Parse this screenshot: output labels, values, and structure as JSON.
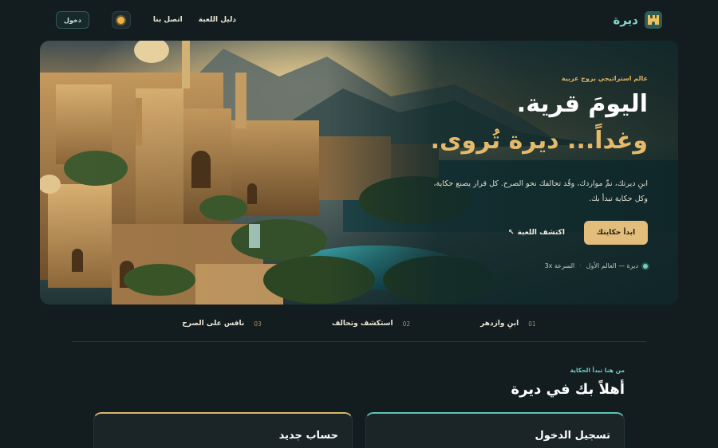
{
  "nav": {
    "brand": "ديرة",
    "links": [
      "دليل اللعبة",
      "اتصل بنا"
    ],
    "login_label": "دخول",
    "theme_icon": "sun-icon"
  },
  "hero": {
    "eyebrow": "عالم استراتيجي بروح عربية",
    "headline_line1": "اليومَ قرية.",
    "headline_line2": "وغداً... ديرة تُروى.",
    "lede": "ابنِ ديرتك، نمِّ مواردك، وقُد تحالفك نحو الصرح. كل قرار يصنع حكاية، وكل حكاية تبدأ بك.",
    "cta_primary": "ابدأ حكايتك",
    "cta_secondary": "اكتشف اللعبة",
    "cta_secondary_icon": "arrow-up-left-icon",
    "meta_world": "ديرة — العالم الأول",
    "meta_speed": "السرعة 3x"
  },
  "steps": [
    {
      "num": "01",
      "label": "ابنِ وازدهر"
    },
    {
      "num": "02",
      "label": "استكشف وتحالف"
    },
    {
      "num": "03",
      "label": "نافس على الصرح"
    }
  ],
  "welcome": {
    "eyebrow": "من هنا تبدأ الحكاية",
    "title": "أهلاً بك في ديرة"
  },
  "cards": {
    "login_title": "تسجيل الدخول",
    "new_account_title": "حساب جديد"
  },
  "colors": {
    "accent_teal": "#6fd0c0",
    "accent_gold": "#e2bd7c",
    "background": "#131c1f"
  }
}
